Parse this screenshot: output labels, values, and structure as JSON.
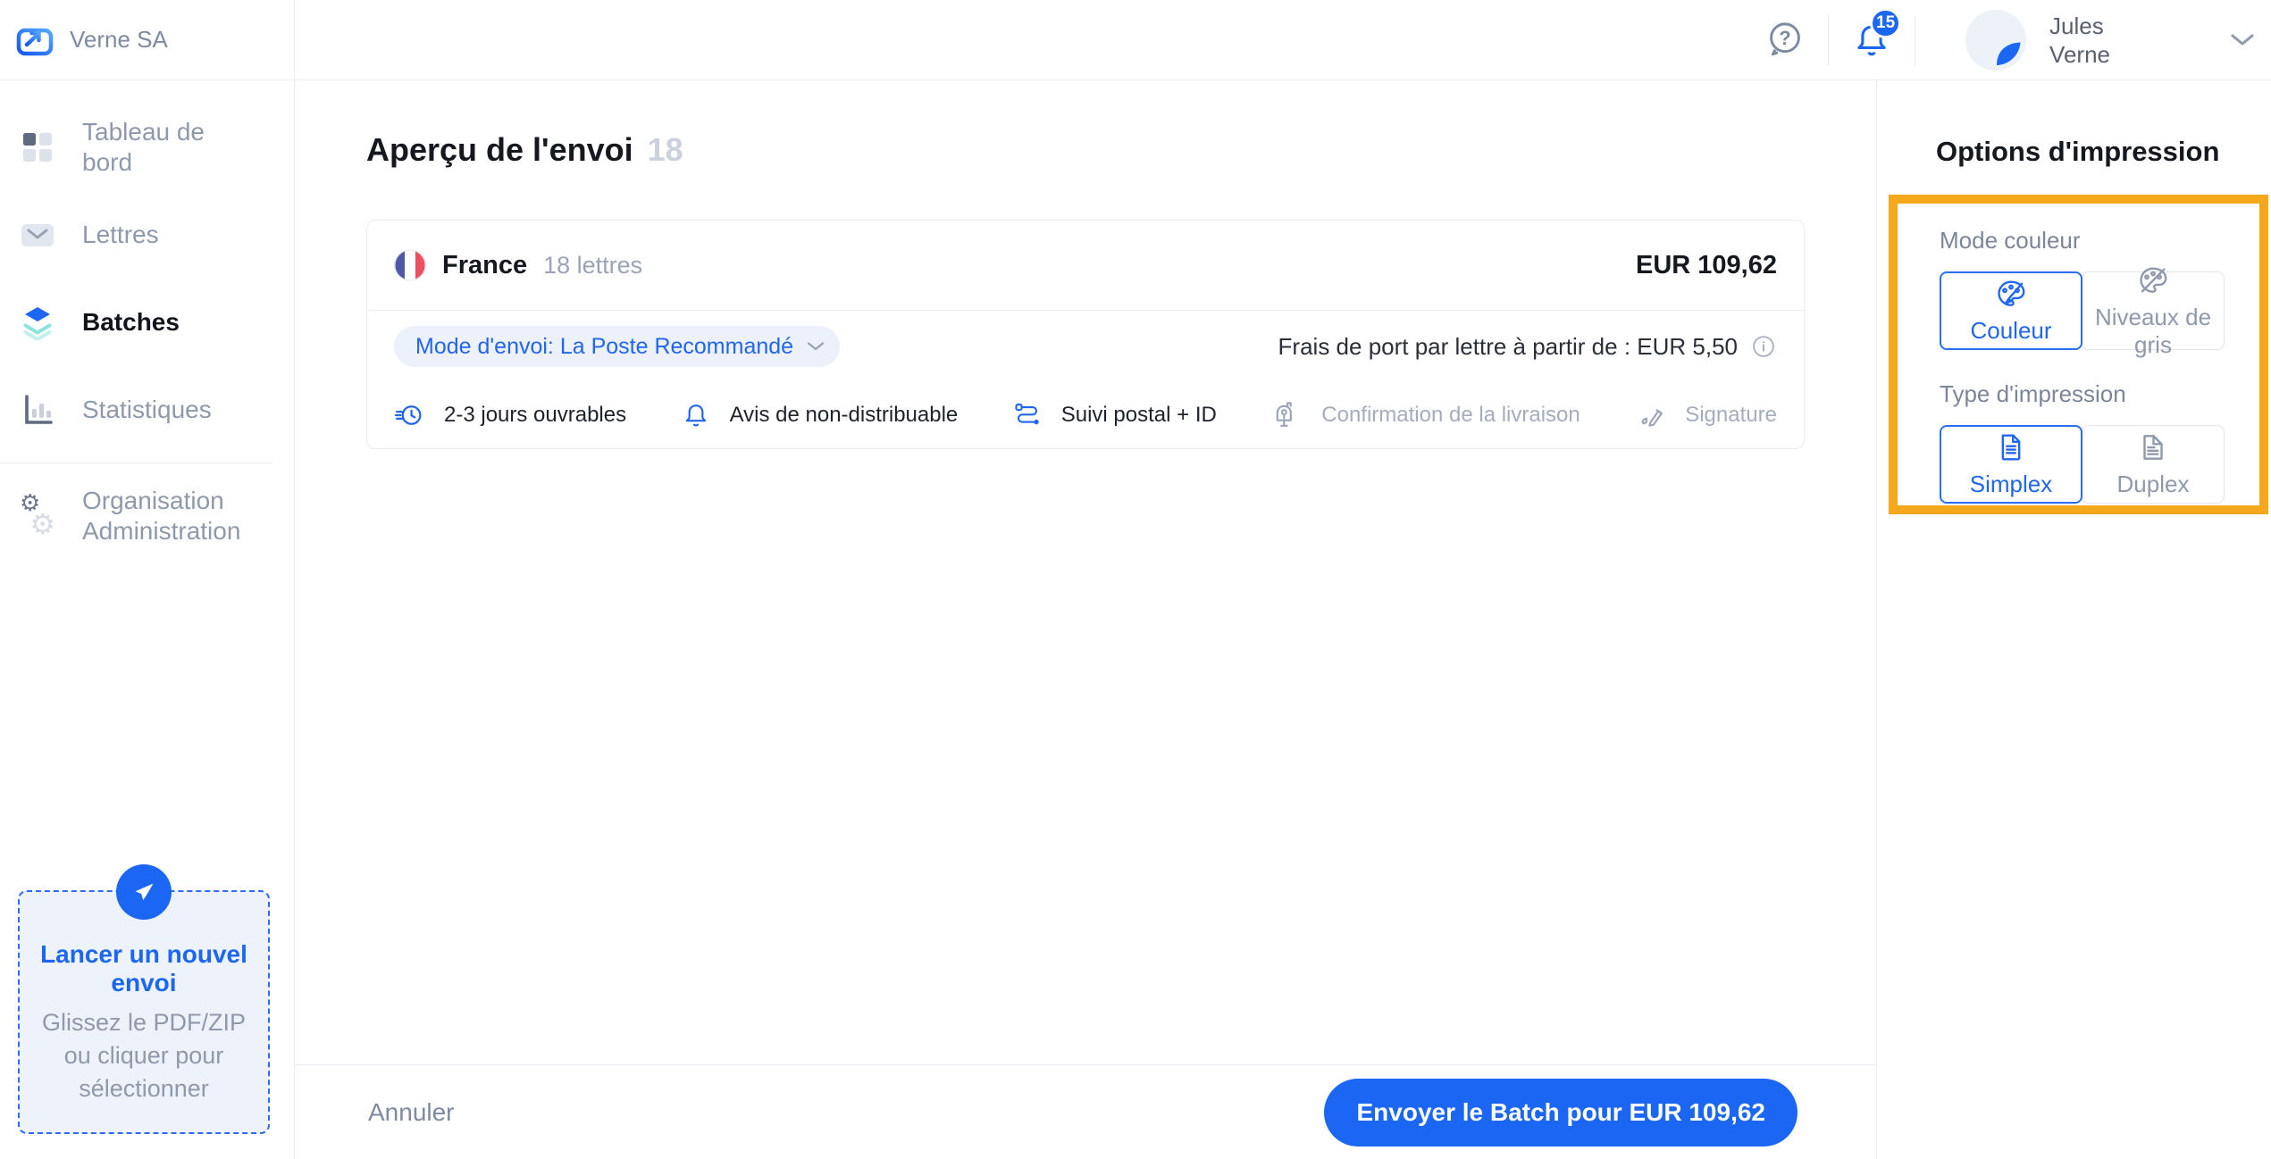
{
  "brand": {
    "name": "Verne SA"
  },
  "topbar": {
    "notifications_count": "15",
    "user_first_name": "Jules",
    "user_last_name": "Verne"
  },
  "sidebar": {
    "items": [
      {
        "label": "Tableau de bord",
        "icon": "dashboard-icon",
        "active": false
      },
      {
        "label": "Lettres",
        "icon": "envelope-icon",
        "active": false
      },
      {
        "label": "Batches",
        "icon": "layers-icon",
        "active": true
      },
      {
        "label": "Statistiques",
        "icon": "bar-chart-icon",
        "active": false
      },
      {
        "label": "Organisation Administration",
        "icon": "gears-icon",
        "active": false
      }
    ],
    "upload": {
      "title": "Lancer un nouvel envoi",
      "subtitle": "Glissez le PDF/ZIP ou cliquer pour sélectionner"
    }
  },
  "main": {
    "title": "Aperçu de l'envoi",
    "title_count": "18",
    "card": {
      "country": "France",
      "letters_count": "18 lettres",
      "total": "EUR 109,62",
      "mode_chip": "Mode d'envoi: La Poste Recommandé",
      "postage_note": "Frais de port par lettre à partir de : EUR 5,50",
      "features": [
        {
          "label": "2-3 jours ouvrables",
          "icon": "clock-fast-icon",
          "enabled": true
        },
        {
          "label": "Avis de non-distribuable",
          "icon": "bell-icon",
          "enabled": true
        },
        {
          "label": "Suivi postal + ID",
          "icon": "route-icon",
          "enabled": true
        },
        {
          "label": "Confirmation de la livraison",
          "icon": "mailbox-icon",
          "enabled": false
        },
        {
          "label": "Signature",
          "icon": "pen-icon",
          "enabled": false
        }
      ]
    },
    "footer": {
      "cancel_label": "Annuler",
      "submit_label": "Envoyer le Batch pour EUR 109,62"
    }
  },
  "print_options": {
    "title": "Options d'impression",
    "color_mode": {
      "label": "Mode couleur",
      "options": [
        {
          "label": "Couleur",
          "selected": true
        },
        {
          "label": "Niveaux de gris",
          "selected": false
        }
      ]
    },
    "print_type": {
      "label": "Type d'impression",
      "options": [
        {
          "label": "Simplex",
          "selected": true
        },
        {
          "label": "Duplex",
          "selected": false
        }
      ]
    }
  },
  "colors": {
    "primary_blue": "#1b66f2",
    "link_blue": "#2166f0",
    "highlight_orange": "#f5a81c",
    "chip_background": "#edf1fc",
    "muted_gray": "#8e99ab",
    "flag_blue": "#4e59a5",
    "flag_red": "#ee4f5e",
    "layers_teal": "#8fe3de"
  }
}
